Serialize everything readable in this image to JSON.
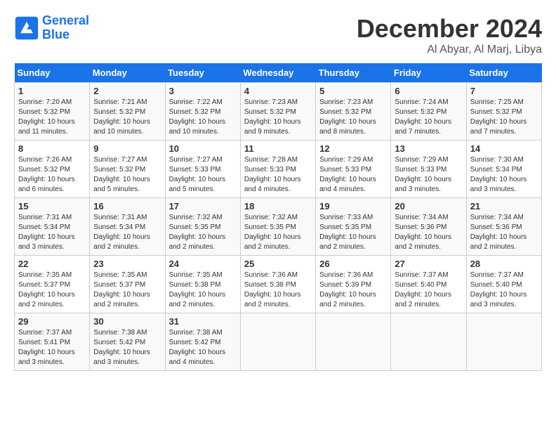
{
  "logo": {
    "line1": "General",
    "line2": "Blue"
  },
  "title": "December 2024",
  "location": "Al Abyar, Al Marj, Libya",
  "days_of_week": [
    "Sunday",
    "Monday",
    "Tuesday",
    "Wednesday",
    "Thursday",
    "Friday",
    "Saturday"
  ],
  "weeks": [
    [
      {
        "day": "1",
        "sunrise": "7:20 AM",
        "sunset": "5:32 PM",
        "daylight": "10 hours and 11 minutes."
      },
      {
        "day": "2",
        "sunrise": "7:21 AM",
        "sunset": "5:32 PM",
        "daylight": "10 hours and 10 minutes."
      },
      {
        "day": "3",
        "sunrise": "7:22 AM",
        "sunset": "5:32 PM",
        "daylight": "10 hours and 10 minutes."
      },
      {
        "day": "4",
        "sunrise": "7:23 AM",
        "sunset": "5:32 PM",
        "daylight": "10 hours and 9 minutes."
      },
      {
        "day": "5",
        "sunrise": "7:23 AM",
        "sunset": "5:32 PM",
        "daylight": "10 hours and 8 minutes."
      },
      {
        "day": "6",
        "sunrise": "7:24 AM",
        "sunset": "5:32 PM",
        "daylight": "10 hours and 7 minutes."
      },
      {
        "day": "7",
        "sunrise": "7:25 AM",
        "sunset": "5:32 PM",
        "daylight": "10 hours and 7 minutes."
      }
    ],
    [
      {
        "day": "8",
        "sunrise": "7:26 AM",
        "sunset": "5:32 PM",
        "daylight": "10 hours and 6 minutes."
      },
      {
        "day": "9",
        "sunrise": "7:27 AM",
        "sunset": "5:32 PM",
        "daylight": "10 hours and 5 minutes."
      },
      {
        "day": "10",
        "sunrise": "7:27 AM",
        "sunset": "5:33 PM",
        "daylight": "10 hours and 5 minutes."
      },
      {
        "day": "11",
        "sunrise": "7:28 AM",
        "sunset": "5:33 PM",
        "daylight": "10 hours and 4 minutes."
      },
      {
        "day": "12",
        "sunrise": "7:29 AM",
        "sunset": "5:33 PM",
        "daylight": "10 hours and 4 minutes."
      },
      {
        "day": "13",
        "sunrise": "7:29 AM",
        "sunset": "5:33 PM",
        "daylight": "10 hours and 3 minutes."
      },
      {
        "day": "14",
        "sunrise": "7:30 AM",
        "sunset": "5:34 PM",
        "daylight": "10 hours and 3 minutes."
      }
    ],
    [
      {
        "day": "15",
        "sunrise": "7:31 AM",
        "sunset": "5:34 PM",
        "daylight": "10 hours and 3 minutes."
      },
      {
        "day": "16",
        "sunrise": "7:31 AM",
        "sunset": "5:34 PM",
        "daylight": "10 hours and 2 minutes."
      },
      {
        "day": "17",
        "sunrise": "7:32 AM",
        "sunset": "5:35 PM",
        "daylight": "10 hours and 2 minutes."
      },
      {
        "day": "18",
        "sunrise": "7:32 AM",
        "sunset": "5:35 PM",
        "daylight": "10 hours and 2 minutes."
      },
      {
        "day": "19",
        "sunrise": "7:33 AM",
        "sunset": "5:35 PM",
        "daylight": "10 hours and 2 minutes."
      },
      {
        "day": "20",
        "sunrise": "7:34 AM",
        "sunset": "5:36 PM",
        "daylight": "10 hours and 2 minutes."
      },
      {
        "day": "21",
        "sunrise": "7:34 AM",
        "sunset": "5:36 PM",
        "daylight": "10 hours and 2 minutes."
      }
    ],
    [
      {
        "day": "22",
        "sunrise": "7:35 AM",
        "sunset": "5:37 PM",
        "daylight": "10 hours and 2 minutes."
      },
      {
        "day": "23",
        "sunrise": "7:35 AM",
        "sunset": "5:37 PM",
        "daylight": "10 hours and 2 minutes."
      },
      {
        "day": "24",
        "sunrise": "7:35 AM",
        "sunset": "5:38 PM",
        "daylight": "10 hours and 2 minutes."
      },
      {
        "day": "25",
        "sunrise": "7:36 AM",
        "sunset": "5:38 PM",
        "daylight": "10 hours and 2 minutes."
      },
      {
        "day": "26",
        "sunrise": "7:36 AM",
        "sunset": "5:39 PM",
        "daylight": "10 hours and 2 minutes."
      },
      {
        "day": "27",
        "sunrise": "7:37 AM",
        "sunset": "5:40 PM",
        "daylight": "10 hours and 2 minutes."
      },
      {
        "day": "28",
        "sunrise": "7:37 AM",
        "sunset": "5:40 PM",
        "daylight": "10 hours and 3 minutes."
      }
    ],
    [
      {
        "day": "29",
        "sunrise": "7:37 AM",
        "sunset": "5:41 PM",
        "daylight": "10 hours and 3 minutes."
      },
      {
        "day": "30",
        "sunrise": "7:38 AM",
        "sunset": "5:42 PM",
        "daylight": "10 hours and 3 minutes."
      },
      {
        "day": "31",
        "sunrise": "7:38 AM",
        "sunset": "5:42 PM",
        "daylight": "10 hours and 4 minutes."
      },
      null,
      null,
      null,
      null
    ]
  ]
}
